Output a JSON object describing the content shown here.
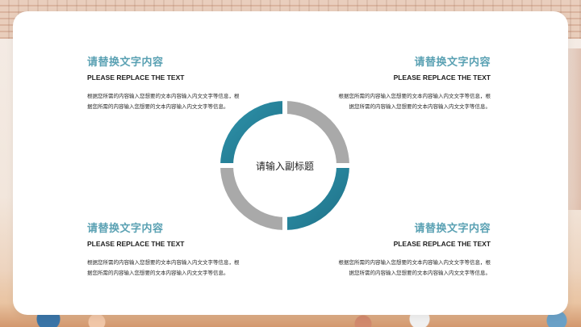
{
  "center": {
    "label": "请输入副标题"
  },
  "blocks": [
    {
      "title": "请替换文字内容",
      "subtitle": "PLEASE REPLACE THE TEXT",
      "body": "根据您所需的内容输入您想要的文本内容输入内文文字等信息，根据您所需的内容输入您想要的文本内容输入内文文字等信息。"
    },
    {
      "title": "请替换文字内容",
      "subtitle": "PLEASE REPLACE THE TEXT",
      "body": "根据您所需的内容输入您想要的文本内容输入内文文字等信息，根据您所需的内容输入您想要的文本内容输入内文文字等信息。"
    },
    {
      "title": "请替换文字内容",
      "subtitle": "PLEASE REPLACE THE TEXT",
      "body": "根据您所需的内容输入您想要的文本内容输入内文文字等信息，根据您所需的内容输入您想要的文本内容输入内文文字等信息。"
    },
    {
      "title": "请替换文字内容",
      "subtitle": "PLEASE REPLACE THE TEXT",
      "body": "根据您所需的内容输入您想要的文本内容输入内文文字等信息，根据您所需的内容输入您想要的文本内容输入内文文字等信息。"
    }
  ],
  "colors": {
    "accent_teal": "#2e8fa8",
    "accent_teal_dark": "#1f6f85",
    "segment_gray": "#a9a9a9",
    "title_teal": "#5aa1b3"
  }
}
